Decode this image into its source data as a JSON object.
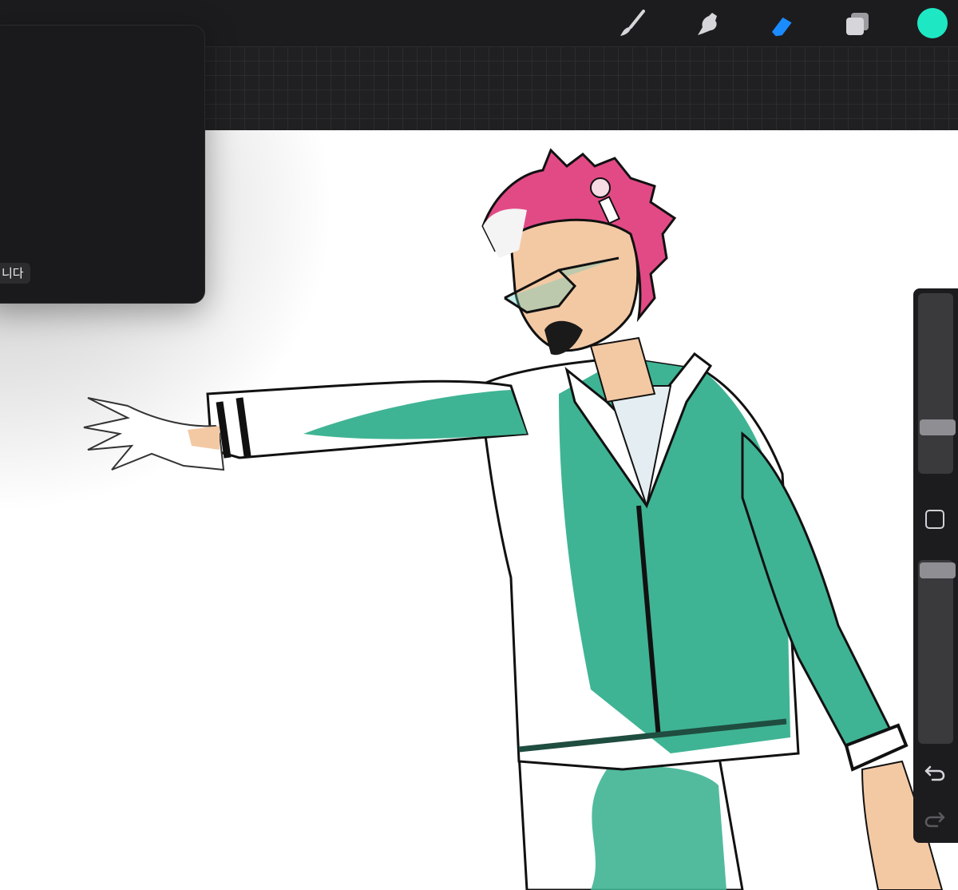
{
  "toolbar": {
    "tools": [
      {
        "name": "brush",
        "icon": "brush-icon",
        "active": false
      },
      {
        "name": "smudge",
        "icon": "smudge-icon",
        "active": false
      },
      {
        "name": "eraser",
        "icon": "eraser-icon",
        "active": true
      },
      {
        "name": "layers",
        "icon": "layers-icon",
        "active": false
      }
    ],
    "current_color": "#1ee8c4",
    "active_tool_color": "#1a8cff"
  },
  "popover": {
    "visible_text": "니다"
  },
  "sidebar": {
    "brush_size_level": 0.68,
    "opacity_level": 0.04,
    "undo_icon": "undo-icon",
    "redo_icon": "redo-icon",
    "modify_icon": "square-icon"
  },
  "colors": {
    "toolbar_bg": "#1c1c1e",
    "jacket_green": "#3fb494",
    "hair_pink": "#e24a86",
    "skin": "#f3c9a4"
  }
}
